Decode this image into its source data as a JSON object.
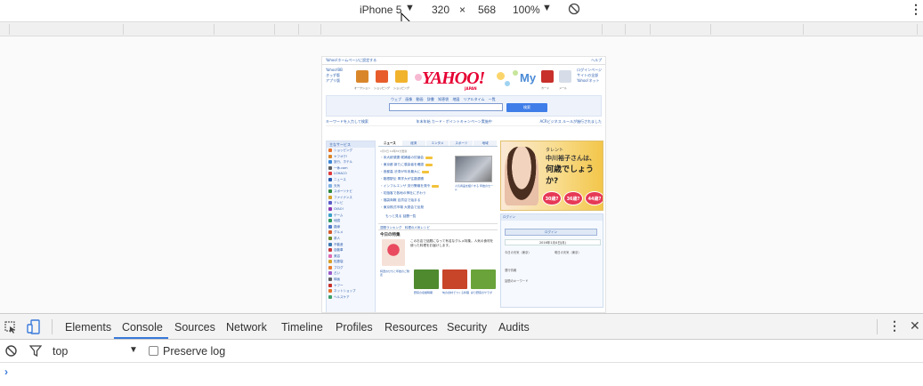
{
  "device_toolbar": {
    "device": "iPhone 5",
    "device_arrow": "▼",
    "width": "320",
    "times": "×",
    "height": "568",
    "zoom": "100%",
    "zoom_arrow": "▼",
    "more": "⋮"
  },
  "phone_page": {
    "top_bar": "Yahoo!ホームページに設定する",
    "top_bar_right": "ヘルプ",
    "left_links": [
      "Yahoo!BB",
      "きっず版",
      "アプリ版"
    ],
    "right_links": [
      "ログインページ",
      "サイトの全部",
      "Yahoo!ネット"
    ],
    "icons": [
      {
        "label": "オークション",
        "color": "#d9862a"
      },
      {
        "label": "ショッピング",
        "color": "#e85c2c"
      },
      {
        "label": "ショッピング",
        "color": "#f1b32c"
      },
      {
        "label": "My Yahoo!",
        "color": "#3d87d6"
      },
      {
        "label": "カード",
        "color": "#c8302b"
      },
      {
        "label": "メール",
        "color": "#9fb1c9"
      }
    ],
    "logo": "YAHOO!",
    "logo_sub": "JAPAN",
    "my": "My",
    "search_tabs": "ウェブ 画像 動画 辞書 知恵袋 地図 リアルタイム 一覧",
    "search_button": "検索",
    "notices": [
      "キーワードを入力して検索",
      "年末年始 カード・ポイントキャンペーン実施中",
      "ACRビジネス ルールが施行されました"
    ],
    "sidebar_head": "主なサービス",
    "sidebar_items": [
      {
        "label": "ショッピング",
        "color": "#e8722c"
      },
      {
        "label": "ヤフオク!",
        "color": "#d9862a"
      },
      {
        "label": "旅行、ホテル",
        "color": "#3d87d6"
      },
      {
        "label": "一休.com",
        "color": "#5d5d5d"
      },
      {
        "label": "LOHACO",
        "color": "#e03a3a"
      },
      {
        "label": "ニュース",
        "color": "#2a5cad"
      },
      {
        "label": "天気",
        "color": "#7fb2e5"
      },
      {
        "label": "スポーツナビ",
        "color": "#2e8b3d"
      },
      {
        "label": "ファイナンス",
        "color": "#d4a12a"
      },
      {
        "label": "テレビ",
        "color": "#5a5ac8"
      },
      {
        "label": "GYAO!",
        "color": "#8a3ab0"
      },
      {
        "label": "ゲーム",
        "color": "#3aa0c8"
      },
      {
        "label": "地図",
        "color": "#2e9a5d"
      },
      {
        "label": "路線",
        "color": "#4f79c6"
      },
      {
        "label": "グルメ",
        "color": "#d45a2a"
      },
      {
        "label": "求人",
        "color": "#6a8a2a"
      },
      {
        "label": "不動産",
        "color": "#3a78b0"
      },
      {
        "label": "自動車",
        "color": "#c83a3a"
      },
      {
        "label": "美容",
        "color": "#e06ab0"
      },
      {
        "label": "知恵袋",
        "color": "#d9a12a"
      },
      {
        "label": "ブログ",
        "color": "#e87a2c"
      },
      {
        "label": "占い",
        "color": "#9a5ac8"
      },
      {
        "label": "映画",
        "color": "#5d5d5d"
      },
      {
        "label": "ヤフー",
        "color": "#c8302b"
      },
      {
        "label": "ネットショップ",
        "color": "#e8722c"
      },
      {
        "label": "ヘルスケア",
        "color": "#3aa06a"
      }
    ],
    "news_tabs": [
      "ニュース",
      "経済",
      "エンタメ",
      "スポーツ",
      "地域"
    ],
    "topics_date": "1月3日 12時32分更新",
    "topics": [
      "米大統領選 候補者の討論会",
      "東京都 新たに感染者を確認",
      "首都高 渋滞が年末最大に",
      "箱根駅伝 青学大が往路優勝",
      "インフルエンザ 流行警報を発令",
      "初詣客で各地の神社にぎわう",
      "福袋商戦 百貨店で始まる",
      "東京株式市場 大発会で反発"
    ],
    "topic_photo_caption": "人気商品を紹介する 年始のセール",
    "topics_more": "もっと見る  話題一覧",
    "bar_line": "週間ランキング　料理の人気レシピ",
    "feature_title": "今日の特集",
    "feature_text": "このお店で話題になって有名なグルメ特集。人気の食材を使った料理をお届けします。",
    "feature_caption": "特選おせちと年始のご馳走",
    "feature_items": [
      "野菜の収穫時期",
      "旬の食材でつくる料理",
      "彩り野菜のサラダ"
    ],
    "ad_line1": "タレント",
    "ad_line2": "中川裕子さんは、",
    "ad_line3": "何歳でしょうか?",
    "ad_circles": [
      "30歳?",
      "36歳?",
      "44歳?"
    ],
    "login_head": "ログイン",
    "login_button": "ログイン",
    "login_date": "2016年1月4日(月)",
    "login_rows": [
      "今日の天気（東京）",
      "明日の天気（東京）",
      "運行情報",
      "話題のキーワード"
    ]
  },
  "devtools": {
    "tabs": [
      "Elements",
      "Console",
      "Sources",
      "Network",
      "Timeline",
      "Profiles",
      "Resources",
      "Security",
      "Audits"
    ],
    "active_tab": "Console",
    "context": "top",
    "preserve_log": "Preserve log",
    "prompt": "›"
  }
}
